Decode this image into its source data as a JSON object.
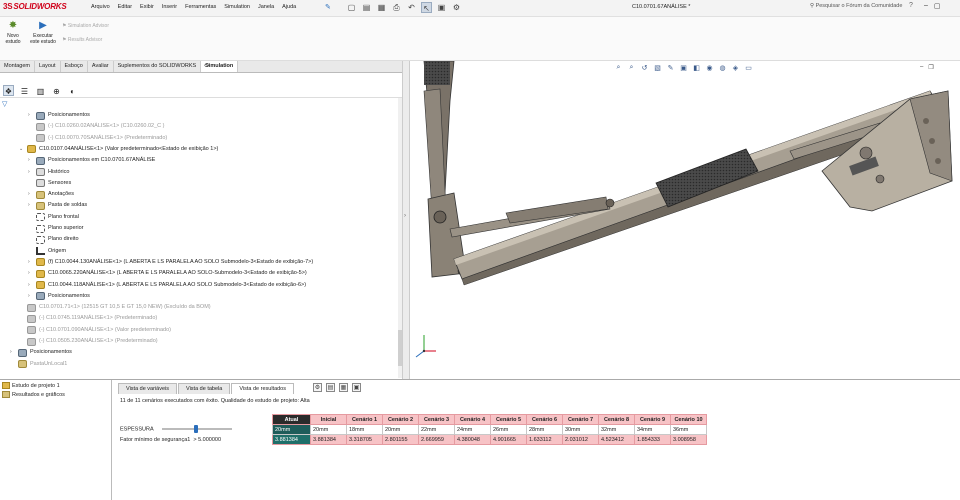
{
  "app": {
    "logo_text": "SOLIDWORKS",
    "logo_prefix": "3S"
  },
  "menu": [
    "Arquivo",
    "Editar",
    "Exibir",
    "Inserir",
    "Ferramentas",
    "Simulation",
    "Janela",
    "Ajuda"
  ],
  "document_title": "C10.0701.67ANÁLISE *",
  "search_placeholder": "Pesquisar o Fórum da Comunidade",
  "ribbon": {
    "new_study": "Novo estudo",
    "run_study": "Executar este estudo",
    "sim_advisor": "Simulation Advisor",
    "results_advisor": "Results Advisor"
  },
  "tabs": [
    "Montagem",
    "Layout",
    "Esboço",
    "Avaliar",
    "Suplementos do SOLIDWORKS",
    "Simulation"
  ],
  "active_tab": "Simulation",
  "tree": [
    {
      "label": "Posicionamentos",
      "icon": "mate",
      "arrow": "›",
      "indent": 1,
      "grey": false
    },
    {
      "label": "(-) C10.0260.02ANÁLISE<1> (C10.0260.02_C )",
      "icon": "part",
      "arrow": "",
      "indent": 1,
      "grey": true
    },
    {
      "label": "(-) C10.0070.70SANÁLISE<1> (Predeterminado)",
      "icon": "part",
      "arrow": "",
      "indent": 1,
      "grey": true
    },
    {
      "label": "C10.0107.04ANÁLISE<1> (Valor predeterminado<Estado de exibição 1>)",
      "icon": "gold",
      "arrow": "⌄",
      "indent": 0,
      "grey": false
    },
    {
      "label": "Posicionamentos em C10.0701.67ANÁLISE",
      "icon": "mate",
      "arrow": "›",
      "indent": 1,
      "grey": false
    },
    {
      "label": "Histórico",
      "icon": "hist",
      "arrow": "›",
      "indent": 1,
      "grey": false
    },
    {
      "label": "Sensores",
      "icon": "hist",
      "arrow": "",
      "indent": 1,
      "grey": false
    },
    {
      "label": "Anotações",
      "icon": "folder",
      "arrow": "›",
      "indent": 1,
      "grey": false
    },
    {
      "label": "Pasta de soldas",
      "icon": "folder",
      "arrow": "›",
      "indent": 1,
      "grey": false
    },
    {
      "label": "Plano frontal",
      "icon": "plane",
      "arrow": "",
      "indent": 1,
      "grey": false
    },
    {
      "label": "Plano superior",
      "icon": "plane",
      "arrow": "",
      "indent": 1,
      "grey": false
    },
    {
      "label": "Plano direito",
      "icon": "plane",
      "arrow": "",
      "indent": 1,
      "grey": false
    },
    {
      "label": "Origem",
      "icon": "origin",
      "arrow": "",
      "indent": 1,
      "grey": false
    },
    {
      "label": "(f) C10.0044.130ANÁLISE<1> (L ABERTA E LS PARALELA AO SOLO Submodelo-3<Estado de exibição-7>)",
      "icon": "gold",
      "arrow": "›",
      "indent": 1,
      "grey": false
    },
    {
      "label": "C10.0065.220ANÁLISE<1> (L ABERTA E LS PARALELA AO SOLO-Submodelo-3<Estado de exibição-5>)",
      "icon": "gold",
      "arrow": "›",
      "indent": 1,
      "grey": false
    },
    {
      "label": "C10.0044.118ANÁLISE<1> (L ABERTA E LS PARALELA AO SOLO Submodelo-3<Estado de exibição-6>)",
      "icon": "gold",
      "arrow": "›",
      "indent": 1,
      "grey": false
    },
    {
      "label": "Posicionamentos",
      "icon": "mate",
      "arrow": "›",
      "indent": 1,
      "grey": false
    },
    {
      "label": "C10.0701.71<1> (12515   GT 10,5 E GT 15,0 NEW) (Excluído da BOM)",
      "icon": "part",
      "arrow": "",
      "indent": 0,
      "grey": true
    },
    {
      "label": "(-) C10.0745.119ANÁLISE<1> (Predeterminado)",
      "icon": "part",
      "arrow": "",
      "indent": 0,
      "grey": true
    },
    {
      "label": "(-) C10.0701.090ANÁLISE<1> (Valor predeterminado)",
      "icon": "part",
      "arrow": "",
      "indent": 0,
      "grey": true
    },
    {
      "label": "(-) C10.0505.230ANÁLISE<1> (Predeterminado)",
      "icon": "part",
      "arrow": "",
      "indent": 0,
      "grey": true
    },
    {
      "label": "Posicionamentos",
      "icon": "mate",
      "arrow": "›",
      "indent": -1,
      "grey": false
    },
    {
      "label": "PastaUnLocal1",
      "icon": "folder",
      "arrow": "",
      "indent": -1,
      "grey": true
    }
  ],
  "study_tree": [
    {
      "label": "Estudo de projeto 1",
      "icon": "gold"
    },
    {
      "label": "Resultados e gráficos",
      "icon": "folder"
    }
  ],
  "design_tabs": [
    "Vista de variáveis",
    "Vista de tabela",
    "Vista de resultados"
  ],
  "active_design_tab": "Vista de resultados",
  "status_message": "11 de 11 cenários executados com êxito. Qualidade do estudo de projeto: Alta",
  "results": {
    "columns": [
      "Atual",
      "Inicial",
      "Cenário 1",
      "Cenário 2",
      "Cenário 3",
      "Cenário 4",
      "Cenário 5",
      "Cenário 6",
      "Cenário 7",
      "Cenário 8",
      "Cenário 9",
      "Cenário 10"
    ],
    "rows": [
      {
        "label": "ESPESSURA",
        "control": "",
        "values": [
          "20mm",
          "20mm",
          "18mm",
          "20mm",
          "22mm",
          "24mm",
          "26mm",
          "28mm",
          "30mm",
          "32mm",
          "34mm",
          "36mm"
        ]
      },
      {
        "label": "Fator mínimo de segurança1",
        "control": "> 5.000000",
        "values": [
          "3.881384",
          "3.881384",
          "3.318705",
          "2.801155",
          "2.669959",
          "4.380048",
          "4.901665",
          "1.633112",
          "2.031012",
          "4.523412",
          "1.854333",
          "3.008958"
        ]
      }
    ]
  }
}
